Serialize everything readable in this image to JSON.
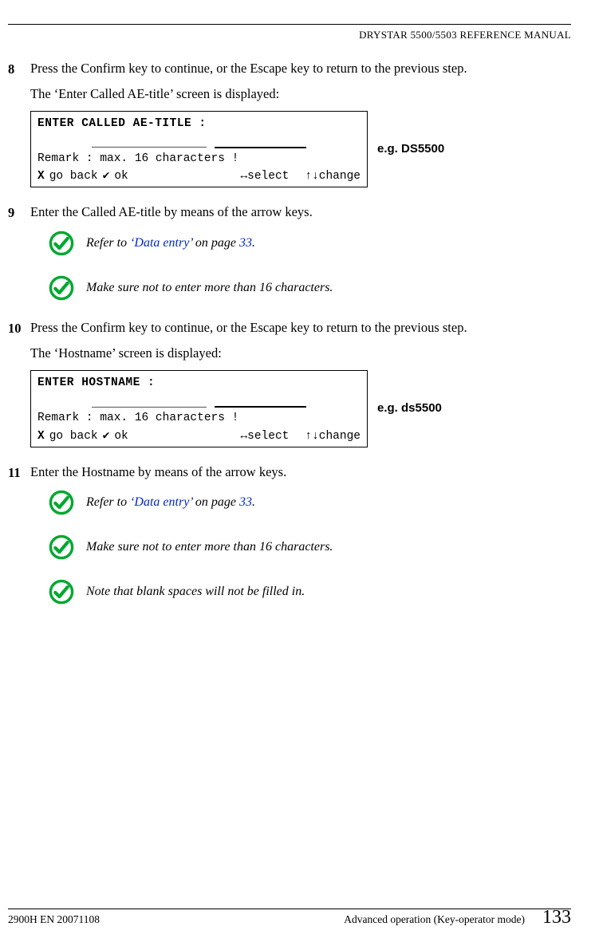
{
  "header": {
    "product": "DRYSTAR 5500/5503 ",
    "doc": "REFERENCE MANUAL"
  },
  "steps": [
    {
      "num": "8",
      "text1": "Press the Confirm key to continue, or the Escape key to return to the previous step.",
      "text2": "The ‘Enter Called AE-title’ screen is displayed:",
      "screen": {
        "title": "ENTER CALLED AE-TITLE :",
        "dashes": "________________",
        "remark": "Remark : max. 16 characters !",
        "foot_back": "go back",
        "foot_ok": "ok",
        "foot_select": "↔select",
        "foot_change": "↑↓change"
      },
      "eg": "e.g. DS5500"
    },
    {
      "num": "9",
      "text1": "Enter the Called AE-title by means of the arrow keys.",
      "tips": [
        {
          "pre": "Refer to ",
          "link": "‘Data entry’",
          "mid": " on page ",
          "page": "33",
          "post": "."
        },
        {
          "plain": "Make sure not to enter more than 16 characters."
        }
      ]
    },
    {
      "num": "10",
      "text1": "Press the Confirm key to continue, or the Escape key to return to the previous step.",
      "text2": "The ‘Hostname’ screen is displayed:",
      "screen": {
        "title": "ENTER HOSTNAME :",
        "dashes": "________________",
        "remark": "Remark : max. 16 characters !",
        "foot_back": "go back",
        "foot_ok": "ok",
        "foot_select": "↔select",
        "foot_change": "↑↓change"
      },
      "eg": "e.g. ds5500"
    },
    {
      "num": "11",
      "text1": "Enter the Hostname by means of the arrow keys.",
      "tips": [
        {
          "pre": "Refer to ",
          "link": "‘Data entry’",
          "mid": " on page ",
          "page": "33",
          "post": "."
        },
        {
          "plain": "Make sure not to enter more than 16 characters."
        },
        {
          "plain": "Note that blank spaces will not be filled in."
        }
      ]
    }
  ],
  "footer": {
    "left": "2900H EN 20071108",
    "center": "Advanced operation (Key-operator mode)",
    "page": "133"
  }
}
